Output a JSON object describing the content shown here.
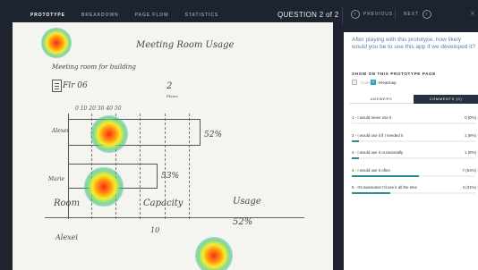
{
  "topbar": {
    "tabs": [
      {
        "label": "PROTOTYPE",
        "active": true
      },
      {
        "label": "BREAKDOWN",
        "active": false
      },
      {
        "label": "PAGE FLOW",
        "active": false
      },
      {
        "label": "STATISTICS",
        "active": false
      }
    ],
    "question_counter": "QUESTION 2 of 2",
    "prev_label": "PREVIOUS",
    "next_label": "NEXT"
  },
  "sketch": {
    "title": "Meeting Room Usage",
    "subtitle": "Meeting room for building",
    "floor": "Flr 06",
    "floors_count": "2",
    "floors_label": "Floors",
    "ticks": "0   10   20   30   40   50",
    "row1": "Alexei",
    "row1_pct": "52%",
    "row2": "Marie",
    "row2_pct": "53%",
    "table_room": "Room",
    "table_capacity": "Capacity",
    "table_usage": "Usage",
    "table_row_room": "Alexei",
    "table_row_capacity": "10",
    "table_row_usage": "52%"
  },
  "panel": {
    "question": "After playing with this prototype, how likely would you be to use this app if we developed it?",
    "show_heading": "SHOW ON THIS PROTOTYPE PAGE",
    "comments_label": "Comments",
    "heatmap_label": "Heatmap",
    "tab_answers": "ANSWERS",
    "tab_comments": "COMMENTS (0)",
    "answers": [
      {
        "label": "1 - I would never use it",
        "value": "0 (0%)",
        "fraction": 0.0
      },
      {
        "label": "2 - I would use it if I needed it",
        "value": "1 (8%)",
        "fraction": 0.08
      },
      {
        "label": "3 - I would use it occasionally",
        "value": "1 (8%)",
        "fraction": 0.08
      },
      {
        "label": "4 - I would use it often",
        "value": "7 (54%)",
        "fraction": 0.54
      },
      {
        "label": "5 - It's awesome! I'd use it all the time",
        "value": "4 (31%)",
        "fraction": 0.31
      }
    ]
  },
  "colors": {
    "topbar_bg": "#1d2430",
    "accent": "#2a8b92",
    "question_text": "#5b7fa6"
  }
}
